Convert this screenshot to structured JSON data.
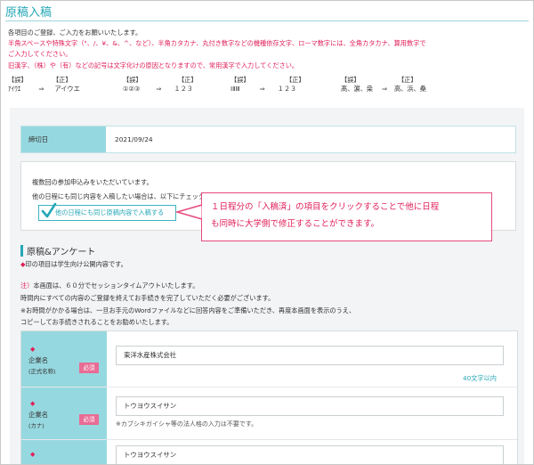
{
  "page": {
    "title": "原稿入稿"
  },
  "intro": {
    "line1": "各項目のご登録、ご入力をお願いいたします。",
    "line2": "半角スペースや特殊文字（\"、/、¥、&、^、など）、半角カタカナ、丸付き数字などの機種依存文字、ローマ数字には、全角カタカナ、算用数字で",
    "line3": "ご入力してください。",
    "line4": "旧漢字、（株）や（有）などの記号は文字化けの原因となりますので、常用漢字で入力してください。"
  },
  "conversions": [
    {
      "wrong_label": "【誤】",
      "wrong": "ｱｲｳｴ",
      "arrow": "⇒",
      "right_label": "【正】",
      "right": "アイウエ"
    },
    {
      "wrong_label": "【誤】",
      "wrong": "①②③",
      "arrow": "⇒",
      "right_label": "【正】",
      "right": "１２３"
    },
    {
      "wrong_label": "【誤】",
      "wrong": "ⅠⅡⅢ",
      "arrow": "⇒",
      "right_label": "【正】",
      "right": "１２３"
    },
    {
      "wrong_label": "【誤】",
      "wrong": "髙、濵、桒",
      "arrow": "⇒",
      "right_label": "【正】",
      "right": "高、浜、桑"
    }
  ],
  "deadline": {
    "label": "締切日",
    "value": "2021/09/24"
  },
  "multi": {
    "line1": "複数回の参加申込みをいただいています。",
    "line2": "他の日程にも同じ内容を入稿したい場合は、以下にチェックを入れてください。",
    "copy_button": "他の日程にも同じ原稿内容で入稿する"
  },
  "callout": {
    "line1": "１日程分の「入稿済」の項目をクリックすることで他に日程",
    "line2": "も同時に大学側で修正することができます。"
  },
  "section": {
    "title": "原稿&アンケート",
    "note_mark": "◆",
    "note": "印の項目は学生向け公開内容です。"
  },
  "warning": {
    "head": "注）",
    "line1": "本画面は、６０分でセッションタイムアウトいたします。",
    "line2": "時間内にすべての内容のご登録を終えてお手続きを完了していただく必要がございます。",
    "line3": "※お時間がかかる場合は、一旦お手元のWordファイルなどに回答内容をご準備いただき、再度本画面を表示のうえ、",
    "line4": "コピーしてお手続きされることをお勧めいたします。"
  },
  "form": {
    "rows": [
      {
        "mark": "◆",
        "name": "企業名",
        "sub": "(正式名称)",
        "required": "必須",
        "value": "東洋水産株式会社",
        "limit": "40文字以内",
        "hint": ""
      },
      {
        "mark": "◆",
        "name": "企業名",
        "sub": "(カナ)",
        "required": "必須",
        "value": "トウヨウスイサン",
        "limit": "",
        "hint": "※カブシキガイシャ等の法人格の入力は不要です。"
      },
      {
        "mark": "◆",
        "name": "",
        "sub": "",
        "required": "",
        "value": "トウヨウスイサン",
        "limit": "",
        "hint": ""
      }
    ]
  },
  "colors": {
    "accent": "#26a7b6",
    "label_bg": "#96d8df",
    "pink": "#e0215a",
    "required_bg": "#e86c95"
  }
}
